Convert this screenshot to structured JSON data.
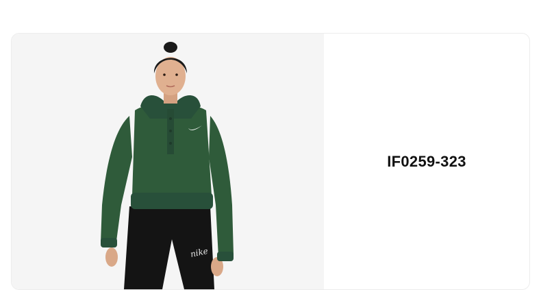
{
  "product": {
    "sku": "IF0259-323",
    "image_alt_icon": "model-wearing-green-cropped-hoodie-image",
    "hoodie_color": "#2f5b3a",
    "pants_color": "#141414",
    "pants_script_text": "nike",
    "background_color": "#f5f5f5"
  }
}
